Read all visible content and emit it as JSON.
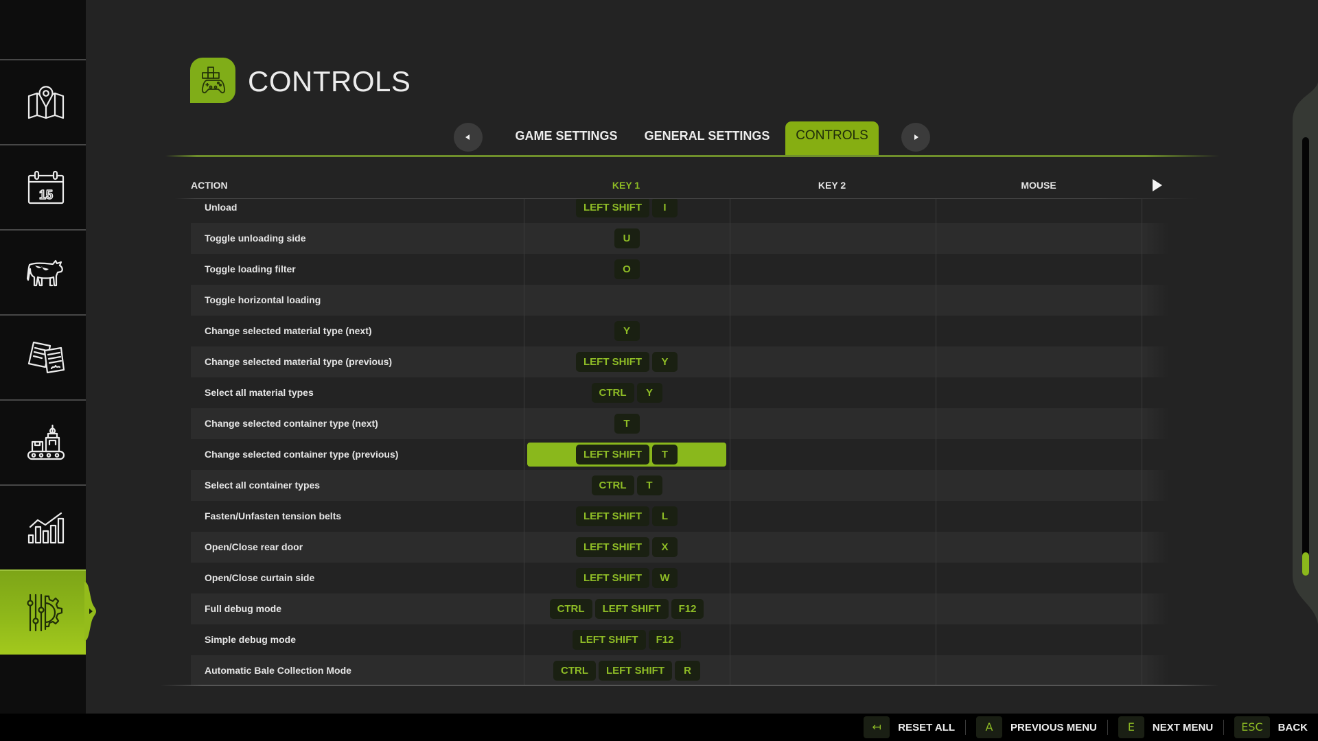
{
  "sidebar": {
    "items": [
      {
        "id": "map",
        "icon": "map-icon"
      },
      {
        "id": "calendar",
        "icon": "calendar-icon",
        "icon_text": "15"
      },
      {
        "id": "animals",
        "icon": "cow-icon"
      },
      {
        "id": "contracts",
        "icon": "contracts-icon"
      },
      {
        "id": "production",
        "icon": "production-icon"
      },
      {
        "id": "statistics",
        "icon": "statistics-icon"
      },
      {
        "id": "settings",
        "icon": "settings-icon",
        "active": true
      }
    ]
  },
  "header": {
    "title": "CONTROLS",
    "icon": "gamepad-keys-icon"
  },
  "tabs": {
    "prev_icon": "triangle-left-icon",
    "next_icon": "triangle-right-icon",
    "items": [
      {
        "label": "GAME SETTINGS",
        "active": false
      },
      {
        "label": "GENERAL SETTINGS",
        "active": false
      },
      {
        "label": "CONTROLS",
        "active": true
      }
    ]
  },
  "table": {
    "columns": [
      {
        "label": "ACTION"
      },
      {
        "label": "KEY 1",
        "active": true
      },
      {
        "label": "KEY 2"
      },
      {
        "label": "MOUSE"
      }
    ],
    "next_column_icon": "play-icon",
    "selected": {
      "row": 8,
      "column": "key1"
    },
    "rows": [
      {
        "action": "Unload",
        "key1": [
          "LEFT SHIFT",
          "I"
        ],
        "key2": [],
        "mouse": []
      },
      {
        "action": "Toggle unloading side",
        "key1": [
          "U"
        ],
        "key2": [],
        "mouse": []
      },
      {
        "action": "Toggle loading filter",
        "key1": [
          "O"
        ],
        "key2": [],
        "mouse": []
      },
      {
        "action": "Toggle horizontal loading",
        "key1": [],
        "key2": [],
        "mouse": []
      },
      {
        "action": "Change selected material type (next)",
        "key1": [
          "Y"
        ],
        "key2": [],
        "mouse": []
      },
      {
        "action": "Change selected material type (previous)",
        "key1": [
          "LEFT SHIFT",
          "Y"
        ],
        "key2": [],
        "mouse": []
      },
      {
        "action": "Select all material types",
        "key1": [
          "CTRL",
          "Y"
        ],
        "key2": [],
        "mouse": []
      },
      {
        "action": "Change selected container type (next)",
        "key1": [
          "T"
        ],
        "key2": [],
        "mouse": []
      },
      {
        "action": "Change selected container type (previous)",
        "key1": [
          "LEFT SHIFT",
          "T"
        ],
        "key2": [],
        "mouse": []
      },
      {
        "action": "Select all container types",
        "key1": [
          "CTRL",
          "T"
        ],
        "key2": [],
        "mouse": []
      },
      {
        "action": "Fasten/Unfasten tension belts",
        "key1": [
          "LEFT SHIFT",
          "L"
        ],
        "key2": [],
        "mouse": []
      },
      {
        "action": "Open/Close rear door",
        "key1": [
          "LEFT SHIFT",
          "X"
        ],
        "key2": [],
        "mouse": []
      },
      {
        "action": "Open/Close curtain side",
        "key1": [
          "LEFT SHIFT",
          "W"
        ],
        "key2": [],
        "mouse": []
      },
      {
        "action": "Full debug mode",
        "key1": [
          "CTRL",
          "LEFT SHIFT",
          "F12"
        ],
        "key2": [],
        "mouse": []
      },
      {
        "action": "Simple debug mode",
        "key1": [
          "LEFT SHIFT",
          "F12"
        ],
        "key2": [],
        "mouse": []
      },
      {
        "action": "Automatic Bale Collection Mode",
        "key1": [
          "CTRL",
          "LEFT SHIFT",
          "R"
        ],
        "key2": [],
        "mouse": []
      }
    ]
  },
  "scrollbar": {
    "position": 1.0
  },
  "footer": {
    "actions": [
      {
        "key": "↤",
        "label": "RESET ALL"
      },
      {
        "key": "A",
        "label": "PREVIOUS MENU"
      },
      {
        "key": "E",
        "label": "NEXT MENU"
      },
      {
        "key": "ESC",
        "label": "BACK"
      }
    ]
  },
  "colors": {
    "accent": "#86ae12",
    "selection": "#8ab81c",
    "keycap_text": "#8fbd26",
    "keycap_bg": "#1a2012",
    "background": "#232323",
    "sidebar": "#0d0d0d",
    "footer": "#000000"
  }
}
